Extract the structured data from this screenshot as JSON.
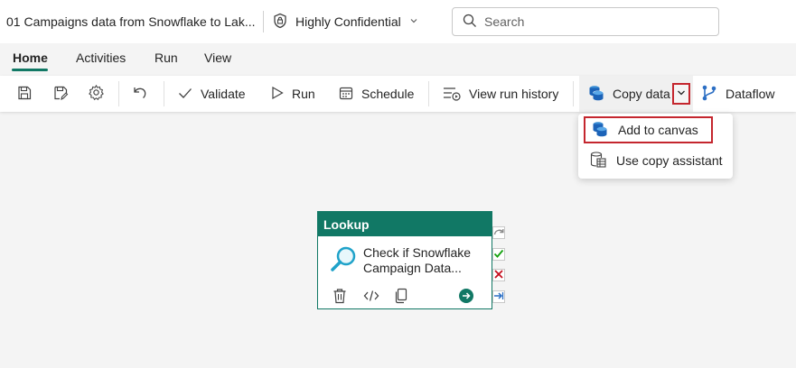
{
  "title_bar": {
    "doc_title": "01 Campaigns data from Snowflake to Lak...",
    "sensitivity_label": "Highly Confidential",
    "search_placeholder": "Search"
  },
  "tabs": [
    {
      "label": "Home",
      "active": true
    },
    {
      "label": "Activities",
      "active": false
    },
    {
      "label": "Run",
      "active": false
    },
    {
      "label": "View",
      "active": false
    }
  ],
  "toolbar": {
    "validate_label": "Validate",
    "run_label": "Run",
    "schedule_label": "Schedule",
    "view_run_history_label": "View run history",
    "copy_data_label": "Copy data",
    "dataflow_label": "Dataflow"
  },
  "copy_data_menu": {
    "items": [
      {
        "label": "Add to canvas",
        "icon": "copy-data-icon",
        "highlighted": true
      },
      {
        "label": "Use copy assistant",
        "icon": "copy-assistant-icon",
        "highlighted": false
      }
    ]
  },
  "activity_card": {
    "type_label": "Lookup",
    "description": "Check if Snowflake Campaign Data..."
  },
  "colors": {
    "accent": "#117865",
    "highlight_border": "#c4262e"
  }
}
